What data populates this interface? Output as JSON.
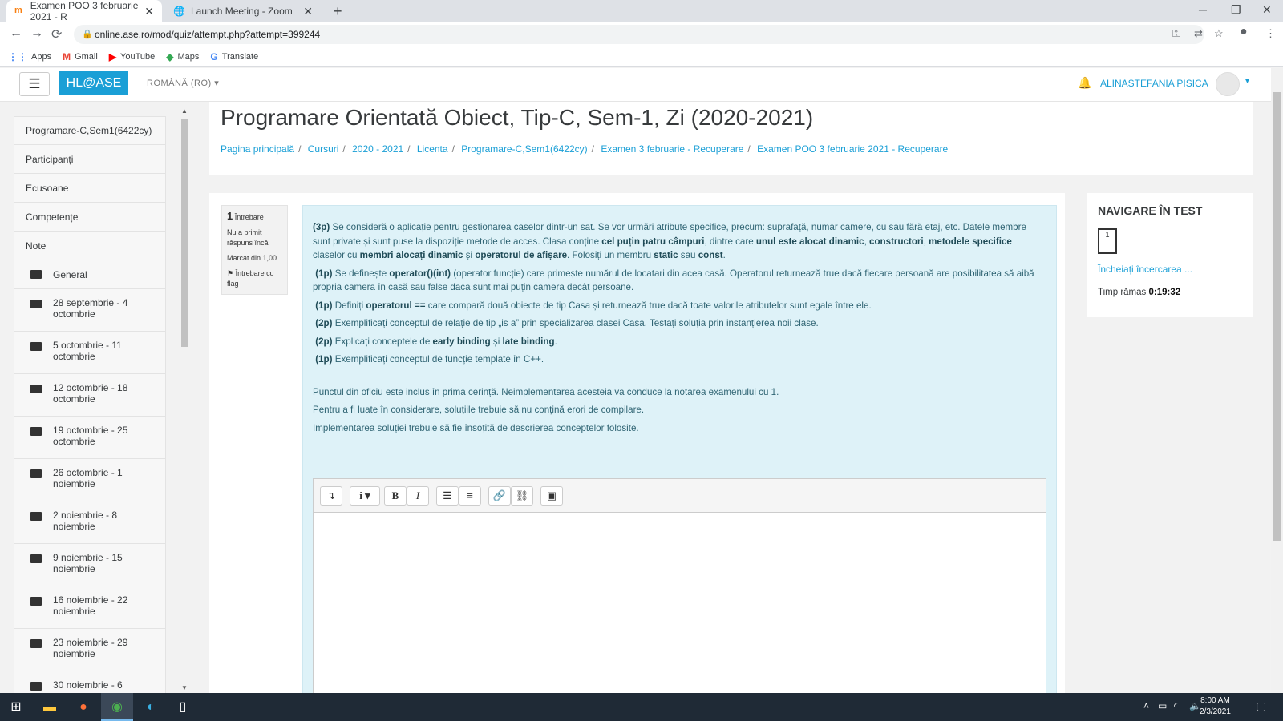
{
  "browser": {
    "tabs": [
      {
        "title": "Examen POO 3 februarie 2021 - R",
        "active": true
      },
      {
        "title": "Launch Meeting - Zoom",
        "active": false
      }
    ],
    "url": "online.ase.ro/mod/quiz/attempt.php?attempt=399244",
    "bookmarks": [
      "Apps",
      "Gmail",
      "YouTube",
      "Maps",
      "Translate"
    ]
  },
  "header": {
    "brand": "HL@ASE",
    "language": "ROMÂNĂ (RO)",
    "user": "ALINASTEFANIA PISICA"
  },
  "sidebar": {
    "items": [
      "Programare-C,Sem1(6422cy)",
      "Participanți",
      "Ecusoane",
      "Competențe",
      "Note"
    ],
    "folders": [
      "General",
      "28 septembrie - 4 octombrie",
      "5 octombrie - 11 octombrie",
      "12 octombrie - 18 octombrie",
      "19 octombrie - 25 octombrie",
      "26 octombrie - 1 noiembrie",
      "2 noiembrie - 8 noiembrie",
      "9 noiembrie - 15 noiembrie",
      "16 noiembrie - 22 noiembrie",
      "23 noiembrie - 29 noiembrie",
      "30 noiembrie - 6"
    ]
  },
  "page": {
    "title": "Programare Orientată Obiect, Tip-C, Sem-1, Zi (2020-2021)",
    "breadcrumb": [
      "Pagina principală",
      "Cursuri",
      "2020 - 2021",
      "Licenta",
      "Programare-C,Sem1(6422cy)",
      "Examen 3 februarie - Recuperare",
      "Examen POO 3 februarie 2021 - Recuperare"
    ]
  },
  "question": {
    "number": "1",
    "label": "Întrebare",
    "status": "Nu a primit răspuns încă",
    "marked": "Marcat din 1,00",
    "flag": "Întrebare cu flag",
    "p1": {
      "pts": "(3p)",
      "t1": " Se consideră o aplicație pentru gestionarea caselor dintr-un sat. Se vor urmări atribute specifice, precum: suprafață, numar camere, cu sau fără etaj, etc. Datele membre sunt private și sunt puse la dispoziție metode de acces. Clasa conține ",
      "b1": "cel puțin patru câmpuri",
      "t2": ", dintre care ",
      "b2": "unul este alocat dinamic",
      "t3": ", ",
      "b3": "constructori",
      "t4": ", ",
      "b4": "metodele specifice",
      "t5": " claselor cu ",
      "b5": "membri alocați dinamic",
      "t6": " și ",
      "b6": "operatorul de afișare",
      "t7": ". Folosiți un membru ",
      "b7": "static",
      "t8": " sau ",
      "b8": "const",
      "t9": "."
    },
    "p2": {
      "pts": "(1p)",
      "t1": " Se definește ",
      "b1": "operator()(int)",
      "t2": " (operator funcție) care primește numărul de locatari din acea casă. Operatorul returnează true dacă fiecare persoană are posibilitatea să aibă propria camera în casă sau false daca sunt mai puțin camera decât persoane."
    },
    "p3": {
      "pts": "(1p)",
      "t1": " Definiți ",
      "b1": "operatorul ==",
      "t2": " care compară două obiecte de tip Casa și returnează true dacă toate valorile atributelor sunt egale între ele."
    },
    "p4": {
      "pts": "(2p)",
      "t1": " Exemplificați conceptul de relație de tip „is a” prin specializarea clasei Casa. Testați soluția prin instanțierea noii clase."
    },
    "p5": {
      "pts": "(2p)",
      "t1": " Explicați conceptele de ",
      "b1": "early binding",
      "t2": " și ",
      "b2": "late binding",
      "t3": "."
    },
    "p6": {
      "pts": "(1p)",
      "t1": " Exemplificați conceptul de funcție template în C++."
    },
    "notes": [
      "Punctul din oficiu este inclus în prima cerință. Neimplementarea acesteia va conduce la notarea examenului cu 1.",
      "Pentru a fi luate în considerare, soluțiile trebuie să nu conțină erori de compilare.",
      "Implementarea soluției trebuie să fie însoțită de descrierea conceptelor folosite."
    ],
    "answer": ""
  },
  "quiznav": {
    "title": "NAVIGARE ÎN TEST",
    "qbutton": "1",
    "finish": "Încheiați încercarea ...",
    "time_label": "Timp rămas",
    "time": "0:19:32"
  },
  "taskbar": {
    "time": "8:00 AM",
    "date": "2/3/2021"
  }
}
